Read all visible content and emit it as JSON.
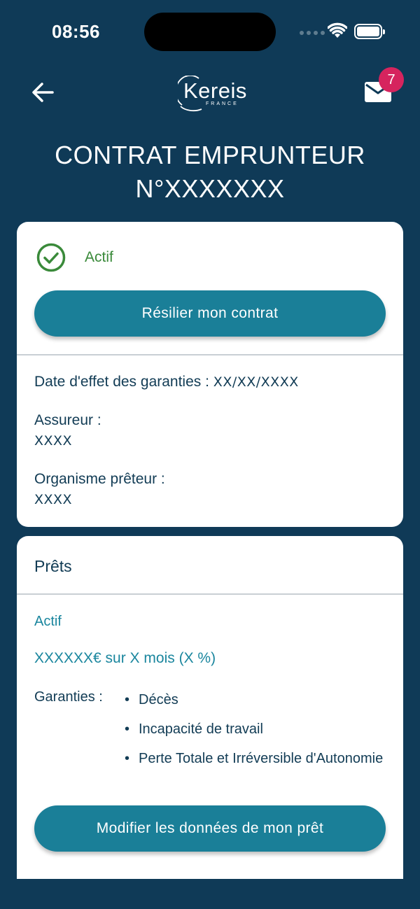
{
  "status_bar": {
    "time": "08:56"
  },
  "header": {
    "logo_text": "Kereis",
    "logo_sub": "FRANCE",
    "mail_badge_count": "7"
  },
  "page_title": {
    "line1": "CONTRAT EMPRUNTEUR",
    "line2": "N°XXXXXXX"
  },
  "contract_card": {
    "status": "Actif",
    "cancel_button": "Résilier mon contrat",
    "effective_date_label": "Date d'effet des garanties",
    "effective_date_sep": " : ",
    "effective_date_value": "XX/XX/XXXX",
    "insurer_label": "Assureur :",
    "insurer_value": "XXXX",
    "lender_label": "Organisme prêteur :",
    "lender_value": "XXXX"
  },
  "loans_card": {
    "title": "Prêts",
    "status": "Actif",
    "amount": "XXXXXX€ sur X mois (X %)",
    "guarantees_label": "Garanties :",
    "guarantees": [
      "Décès",
      "Incapacité de travail",
      "Perte Totale et Irréversible d'Autonomie"
    ],
    "edit_button": "Modifier les données de mon prêt"
  },
  "colors": {
    "background": "#0f3a57",
    "primary_button": "#1a7f98",
    "active_green": "#3a8a3a",
    "badge": "#d6245e",
    "accent_teal": "#1a869e"
  }
}
